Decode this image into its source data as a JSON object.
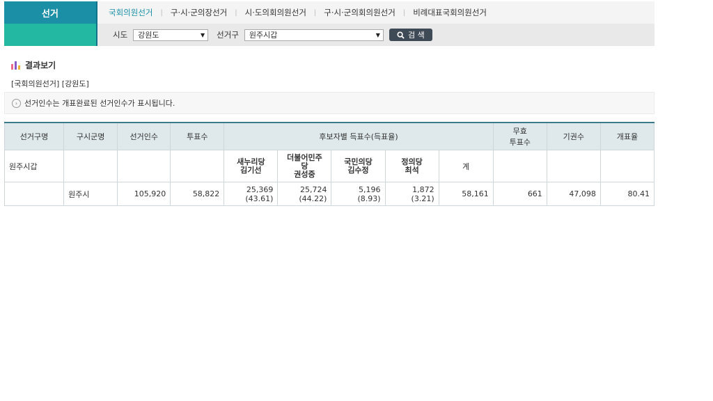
{
  "nav": {
    "section_title": "선거",
    "menu": [
      {
        "label": "국회의원선거",
        "active": true
      },
      {
        "label": "구·시·군의장선거",
        "active": false
      },
      {
        "label": "시·도의회의원선거",
        "active": false
      },
      {
        "label": "구·시·군의회의원선거",
        "active": false
      },
      {
        "label": "비례대표국회의원선거",
        "active": false
      }
    ]
  },
  "filters": {
    "sido_label": "시도",
    "sido_value": "강원도",
    "district_label": "선거구",
    "district_value": "원주시갑",
    "search_label": "검 색"
  },
  "result": {
    "title": "결과보기",
    "subtitle": "[국회의원선거] [강원도]",
    "notice": "선거인수는 개표완료된 선거인수가 표시됩니다."
  },
  "table": {
    "headers": {
      "district": "선거구명",
      "sigungu": "구시군명",
      "electors": "선거인수",
      "voters": "투표수",
      "candidates": "후보자별 득표수(득표율)",
      "invalid_line1": "무효",
      "invalid_line2": "투표수",
      "abstain": "기권수",
      "count_rate": "개표율"
    },
    "district_name": "원주시갑",
    "candidates": [
      {
        "party": "새누리당",
        "name": "김기선"
      },
      {
        "party": "더불어민주\n당",
        "name": "권성중"
      },
      {
        "party": "국민의당",
        "name": "김수정"
      },
      {
        "party": "정의당",
        "name": "최석"
      }
    ],
    "total_label": "계",
    "row": {
      "sigungu": "원주시",
      "electors": "105,920",
      "voters": "58,822",
      "votes": [
        {
          "count": "25,369",
          "rate": "(43.61)"
        },
        {
          "count": "25,724",
          "rate": "(44.22)"
        },
        {
          "count": "5,196",
          "rate": "(8.93)"
        },
        {
          "count": "1,872",
          "rate": "(3.21)"
        }
      ],
      "total": "58,161",
      "invalid": "661",
      "abstain": "47,098",
      "count_rate": "80.41"
    }
  },
  "colors": {
    "accent": "#1a8fa6",
    "accent2": "#22b8a2",
    "header_bg": "#dfe8ea",
    "button": "#3f4a57"
  }
}
